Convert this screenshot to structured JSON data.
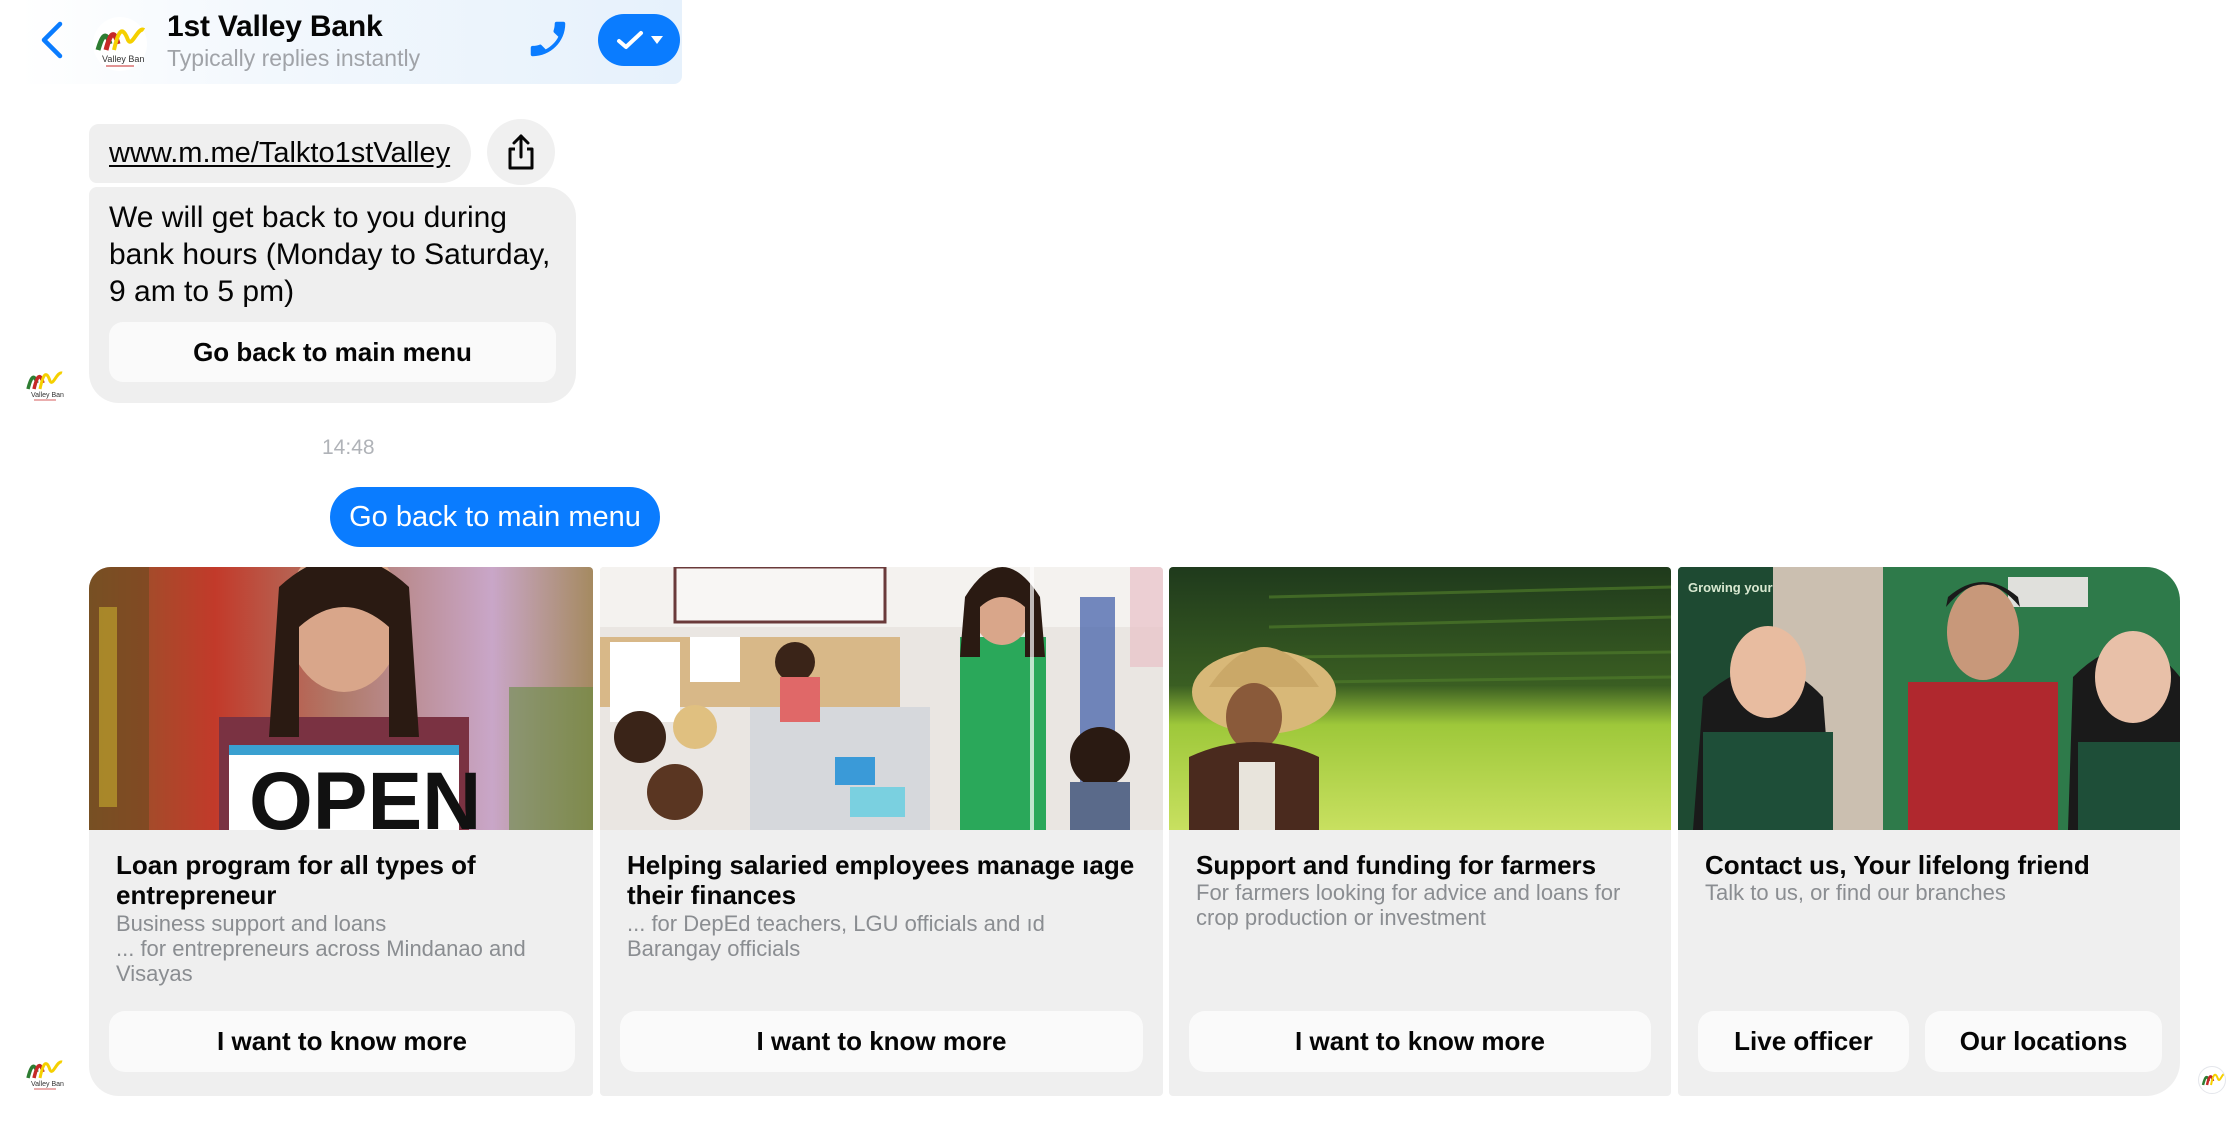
{
  "header": {
    "title": "1st Valley Bank",
    "subtitle": "Typically replies instantly",
    "back_icon": "chevron-left-icon",
    "phone_icon": "phone-icon",
    "status_icon": "checkmark-icon",
    "accent_color": "#0a7cff"
  },
  "logo": {
    "text": "Valley Ban",
    "colors": [
      "#2e7d32",
      "#c62828",
      "#f5d000"
    ]
  },
  "messages": {
    "link": "www.m.me/Talkto1stValley",
    "share_icon": "share-icon",
    "hours_text": "We will get back to you during bank hours (Monday to Saturday, 9 am to 5 pm)",
    "hours_button": "Go back to main menu",
    "timestamp": "14:48",
    "user_message": "Go back to main menu"
  },
  "cards": [
    {
      "title": "Loan program for all types of entrepreneur",
      "subtitle_lines": [
        "Business support and loans",
        "... for entrepreneurs across Mindanao and Visayas"
      ],
      "image": "woman holding OPEN sign in store",
      "buttons": [
        "I want to know more"
      ]
    },
    {
      "title": "Helping salaried employees manage ıage their finances",
      "subtitle_lines": [
        "... for DepEd teachers, LGU officials and      ıd Barangay officials"
      ],
      "image": "teacher in classroom with children",
      "buttons": [
        "I want to know more"
      ]
    },
    {
      "title": "Support and funding for farmers",
      "subtitle_lines": [
        "For farmers looking for advice and loans for crop production or investment"
      ],
      "image": "farmer with straw hat in rice field",
      "buttons": [
        "I want to know more"
      ]
    },
    {
      "title": "Contact us, Your lifelong friend",
      "subtitle_lines": [
        "Talk to us, or find our branches"
      ],
      "image": "bank staff standing together",
      "buttons": [
        "Live officer",
        "Our locations"
      ]
    }
  ]
}
